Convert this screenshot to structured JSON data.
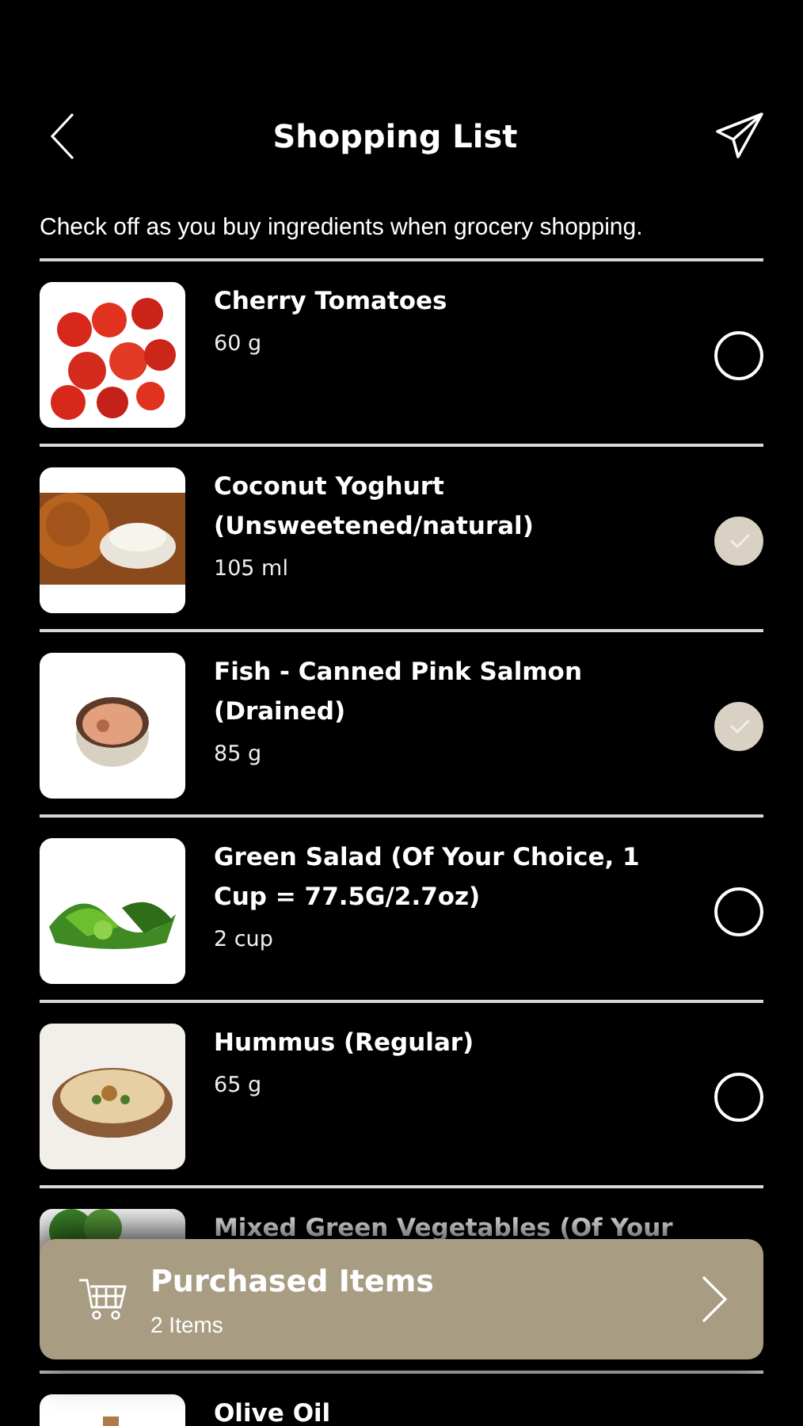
{
  "header": {
    "title": "Shopping List"
  },
  "instructions": "Check off as you buy ingredients when grocery shopping.",
  "items": [
    {
      "name": "Cherry Tomatoes",
      "quantity": "60 g",
      "checked": false
    },
    {
      "name": "Coconut Yoghurt (Unsweetened/natural)",
      "quantity": "105 ml",
      "checked": true
    },
    {
      "name": "Fish - Canned Pink Salmon (Drained)",
      "quantity": "85 g",
      "checked": true
    },
    {
      "name": "Green Salad (Of Your Choice, 1 Cup = 77.5G/2.7oz)",
      "quantity": "2 cup",
      "checked": false
    },
    {
      "name": "Hummus (Regular)",
      "quantity": "65 g",
      "checked": false
    },
    {
      "name": "Mixed Green Vegetables (Of Your"
    },
    {
      "name": "Olive Oil"
    }
  ],
  "purchased_bar": {
    "title": "Purchased Items",
    "count": "2 Items"
  }
}
